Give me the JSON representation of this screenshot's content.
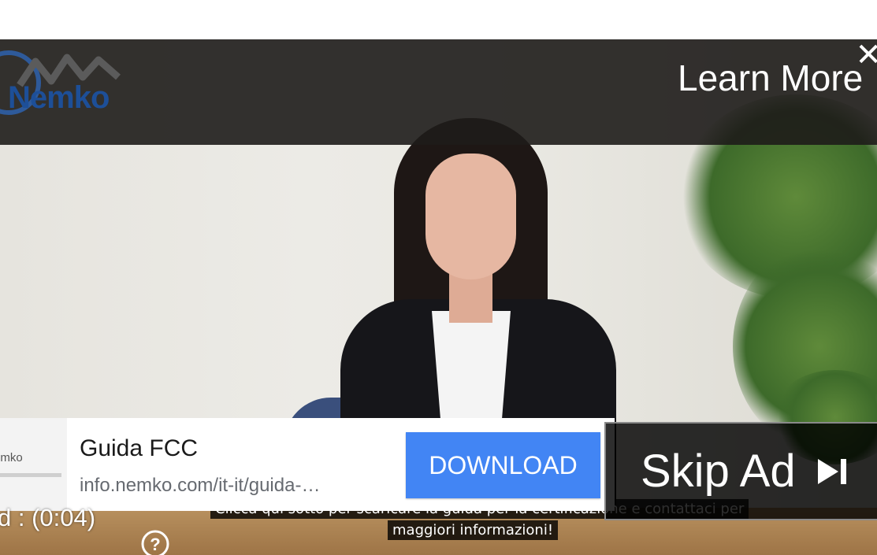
{
  "ad_overlay": {
    "brand_logo_text": "Nemko",
    "learn_more_label": "Learn More",
    "close_symbol": "✕"
  },
  "ad_card": {
    "thumbnail_text": "emko",
    "title": "Guida FCC",
    "url": "info.nemko.com/it-it/guida-…",
    "download_label": "DOWNLOAD",
    "download_color": "#4285f4"
  },
  "skip_ad": {
    "label": "Skip Ad",
    "icon": "skip-next-icon"
  },
  "captions": {
    "line1": "Clicca qui sotto per scaricare la guida per la certificazione e contattaci per",
    "line2": "maggiori informazioni!"
  },
  "ad_timer": {
    "text": "d : (0:04)"
  },
  "help": {
    "icon": "help-icon",
    "symbol": "?"
  }
}
